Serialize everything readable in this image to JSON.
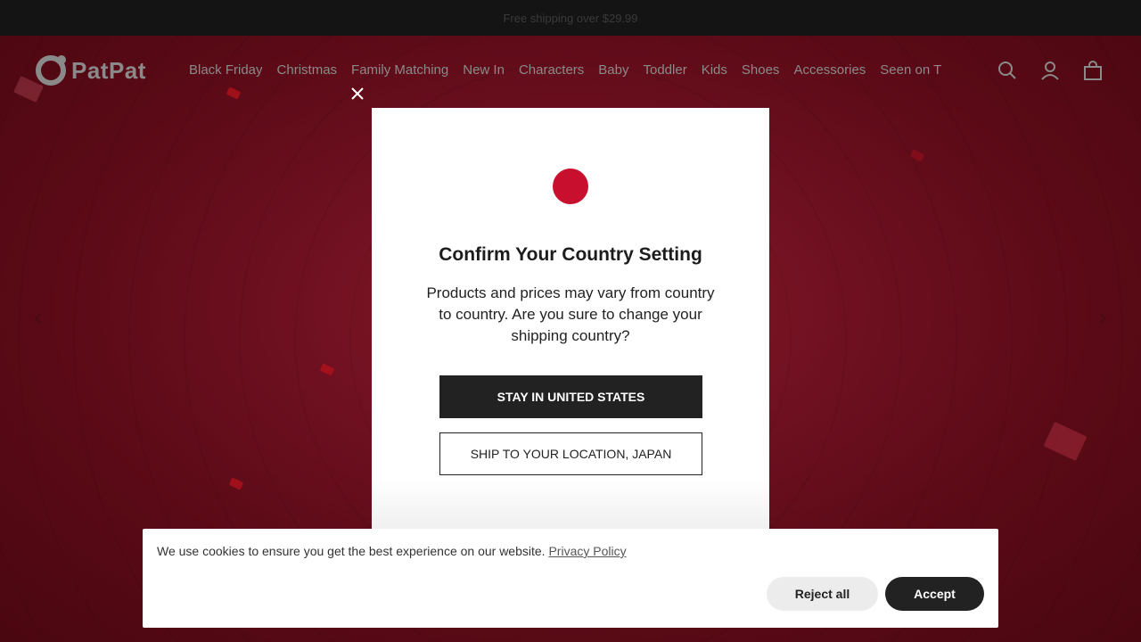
{
  "topbar": {
    "announcement": "Free shipping over $29.99"
  },
  "header": {
    "logo_text": "PatPat",
    "nav": [
      "Black Friday",
      "Christmas",
      "Family Matching",
      "New In",
      "Characters",
      "Baby",
      "Toddler",
      "Kids",
      "Shoes",
      "Accessories",
      "Seen on T"
    ],
    "icons": [
      "search-icon",
      "account-icon",
      "cart-icon"
    ]
  },
  "modal": {
    "title": "Confirm Your Country Setting",
    "description": "Products and prices may vary from country to country. Are you sure to change your shipping country?",
    "stay_label": "STAY IN UNITED STATES",
    "ship_label": "SHIP TO YOUR LOCATION, JAPAN",
    "flag": "japan-flag",
    "flag_color": "#c8102e"
  },
  "cookie": {
    "message": "We use cookies to ensure you get the best experience on our website.",
    "policy_link": "Privacy Policy",
    "reject_label": "Reject all",
    "accept_label": "Accept"
  },
  "colors": {
    "hero_bg": "#6e1020",
    "dark": "#222222"
  }
}
